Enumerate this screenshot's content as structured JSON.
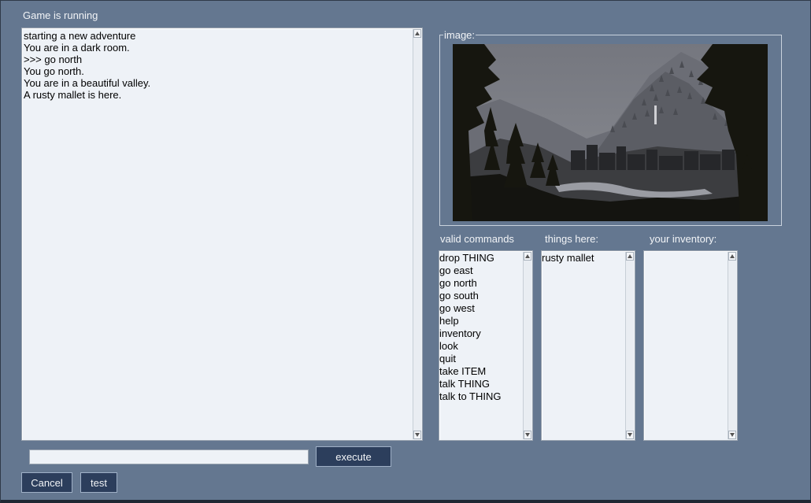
{
  "window": {
    "title": "Game is running"
  },
  "output": {
    "lines": [
      "starting a new adventure",
      "You are in a dark room.",
      ">>> go north",
      "You go north.",
      "You are in a beautiful valley.",
      "A rusty mallet is here."
    ]
  },
  "image_panel": {
    "legend": "image:"
  },
  "commands": {
    "label": "valid commands",
    "items": [
      "drop THING",
      "go east",
      "go north",
      "go south",
      "go west",
      "help",
      "inventory",
      "look",
      "quit",
      "take ITEM",
      "talk THING",
      "talk to THING"
    ]
  },
  "things": {
    "label": "things here:",
    "items": [
      "rusty mallet"
    ]
  },
  "inventory": {
    "label": "your inventory:",
    "items": []
  },
  "input": {
    "value": "",
    "placeholder": ""
  },
  "buttons": {
    "execute": "execute",
    "cancel": "Cancel",
    "test": "test"
  },
  "colors": {
    "background": "#647790",
    "button": "#2c3e5c",
    "textbox": "#eef2f7"
  },
  "icons": {
    "scroll_up": "scroll-up-arrow-icon",
    "scroll_down": "scroll-down-arrow-icon"
  }
}
